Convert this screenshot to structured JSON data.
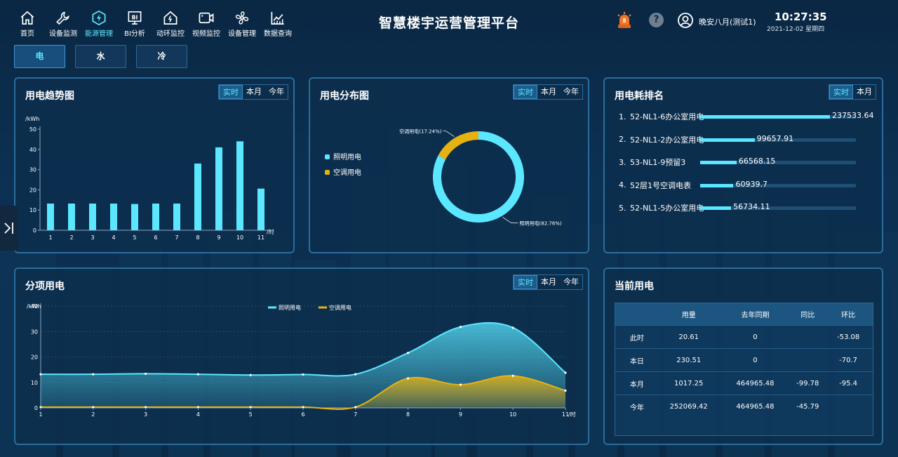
{
  "app": {
    "title": "智慧楼宇运营管理平台",
    "user": "晚安八月(测试1)",
    "time": "10:27:35",
    "date": "2021-12-02 星期四"
  },
  "nav": [
    {
      "label": "首页",
      "icon": "home-icon"
    },
    {
      "label": "设备监测",
      "icon": "wrench-icon"
    },
    {
      "label": "能源管理",
      "icon": "energy-icon",
      "active": true
    },
    {
      "label": "BI分析",
      "icon": "bi-icon"
    },
    {
      "label": "动环监控",
      "icon": "house-icon"
    },
    {
      "label": "视频监控",
      "icon": "camera-icon"
    },
    {
      "label": "设备管理",
      "icon": "fan-icon"
    },
    {
      "label": "数据查询",
      "icon": "chart-icon"
    }
  ],
  "sub_tabs": [
    "电",
    "水",
    "冷"
  ],
  "range_tabs": [
    "实时",
    "本月",
    "今年"
  ],
  "trend": {
    "title": "用电趋势图",
    "chart_data": {
      "type": "bar",
      "categories": [
        "1",
        "2",
        "3",
        "4",
        "5",
        "6",
        "7",
        "8",
        "9",
        "10",
        "11"
      ],
      "values": [
        13.2,
        13.2,
        13.2,
        13.2,
        13.0,
        13.2,
        13.2,
        33.0,
        41.0,
        44.0,
        20.6
      ],
      "ylabel": "/kWh",
      "xlabel": "/时",
      "ylim": [
        0,
        50
      ],
      "yticks": [
        0,
        10,
        20,
        30,
        40,
        50
      ],
      "color": "#5ae7ff"
    }
  },
  "dist": {
    "title": "用电分布图",
    "legend": [
      {
        "label": "照明用电",
        "color": "#5ae7ff"
      },
      {
        "label": "空调用电",
        "color": "#e6b212"
      }
    ],
    "chart_data": {
      "type": "pie",
      "slices": [
        {
          "name": "照明用电",
          "value": 82.76,
          "label": "照明用电(82.76%)",
          "color": "#5ae7ff"
        },
        {
          "name": "空调用电",
          "value": 17.24,
          "label": "空调用电(17.24%)",
          "color": "#e6b212"
        }
      ]
    }
  },
  "ranking": {
    "title": "用电耗排名",
    "tabs": [
      "实时",
      "本月"
    ],
    "items": [
      {
        "idx": "1.",
        "name": "52-NL1-6办公室用电",
        "value": 237533.64,
        "label": "237533.64"
      },
      {
        "idx": "2.",
        "name": "52-NL1-2办公室用电",
        "value": 99657.91,
        "label": "99657.91"
      },
      {
        "idx": "3.",
        "name": "53-NL1-9预留3",
        "value": 66568.15,
        "label": "66568.15"
      },
      {
        "idx": "4.",
        "name": "52层1号空调电表",
        "value": 60939.7,
        "label": "60939.7"
      },
      {
        "idx": "5.",
        "name": "52-NL1-5办公室用电",
        "value": 56734.11,
        "label": "56734.11"
      }
    ]
  },
  "sub": {
    "title": "分项用电",
    "chart_data": {
      "type": "area",
      "x": [
        "1",
        "2",
        "3",
        "4",
        "5",
        "6",
        "7",
        "8",
        "9",
        "10",
        "11"
      ],
      "xlabel": "/时",
      "ylabel": "/kWh",
      "ylim": [
        0,
        40
      ],
      "yticks": [
        0,
        10,
        20,
        30,
        40
      ],
      "legend_position": "top-center",
      "series": [
        {
          "name": "照明用电",
          "color": "#5ae7ff",
          "values": [
            13.2,
            13.2,
            13.4,
            13.2,
            12.9,
            13.1,
            13.2,
            21.6,
            31.8,
            31.5,
            13.8
          ]
        },
        {
          "name": "空调用电",
          "color": "#e6b212",
          "values": [
            0.3,
            0.3,
            0.3,
            0.3,
            0.3,
            0.3,
            0.3,
            11.6,
            9.1,
            12.6,
            6.8
          ]
        }
      ]
    }
  },
  "current": {
    "title": "当前用电",
    "headers": [
      "",
      "用量",
      "去年同期",
      "同比",
      "环比"
    ],
    "rows": [
      [
        "此时",
        "20.61",
        "0",
        "",
        "-53.08"
      ],
      [
        "本日",
        "230.51",
        "0",
        "",
        "-70.7"
      ],
      [
        "本月",
        "1017.25",
        "464965.48",
        "-99.78",
        "-95.4"
      ],
      [
        "今年",
        "252069.42",
        "464965.48",
        "-45.79",
        ""
      ]
    ]
  }
}
